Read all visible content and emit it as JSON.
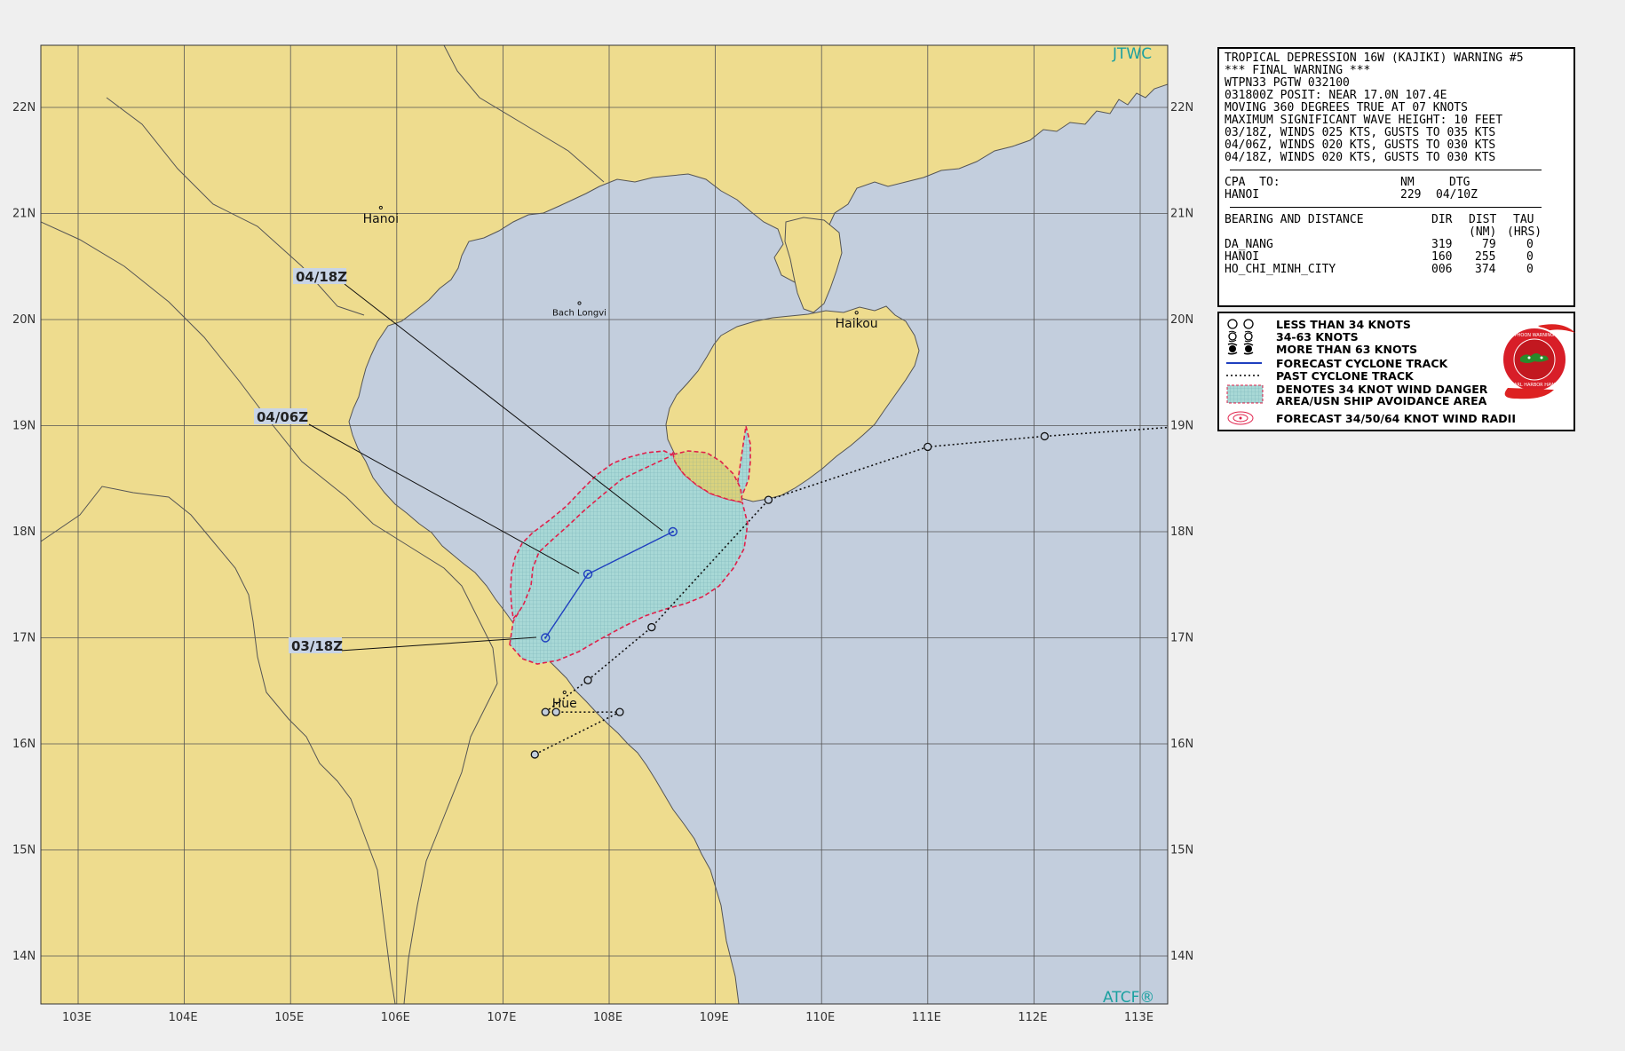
{
  "map": {
    "lat_labels": [
      "22N",
      "21N",
      "20N",
      "19N",
      "18N",
      "17N",
      "16N",
      "15N",
      "14N"
    ],
    "lon_labels": [
      "103E",
      "104E",
      "105E",
      "106E",
      "107E",
      "108E",
      "109E",
      "110E",
      "111E",
      "112E",
      "113E"
    ],
    "places": [
      {
        "name": "Hanoi",
        "lon": 105.85,
        "lat": 21.03
      },
      {
        "name": "Bach Longvi",
        "lon": 107.72,
        "lat": 20.13
      },
      {
        "name": "Haikou",
        "lon": 110.33,
        "lat": 20.04
      },
      {
        "name": "Hue",
        "lon": 107.58,
        "lat": 16.46
      }
    ],
    "brand_top": "JTWC",
    "brand_bottom": "ATCF®",
    "forecast_track": [
      {
        "tau": "03/18Z",
        "lon": 107.4,
        "lat": 17.0
      },
      {
        "tau": "04/06Z",
        "lon": 107.8,
        "lat": 17.6
      },
      {
        "tau": "04/18Z",
        "lon": 108.6,
        "lat": 18.0
      }
    ],
    "past_track": [
      {
        "lon": 113.5,
        "lat": 19.0
      },
      {
        "lon": 112.1,
        "lat": 18.9
      },
      {
        "lon": 111.0,
        "lat": 18.8
      },
      {
        "lon": 109.5,
        "lat": 18.3
      },
      {
        "lon": 108.4,
        "lat": 17.1
      },
      {
        "lon": 107.8,
        "lat": 16.6
      },
      {
        "lon": 107.4,
        "lat": 16.3
      },
      {
        "lon": 107.5,
        "lat": 16.3
      },
      {
        "lon": 108.1,
        "lat": 16.3
      },
      {
        "lon": 107.3,
        "lat": 15.9
      }
    ]
  },
  "colors": {
    "land": "#eedc8e",
    "sea": "#c3cedd",
    "forecast_track": "#1f3fbf",
    "danger_fill": "#9fd3d3",
    "danger_edge": "#e0204a"
  },
  "info": {
    "lines": [
      "TROPICAL DEPRESSION 16W (KAJIKI) WARNING #5",
      "*** FINAL WARNING ***",
      "WTPN33 PGTW 032100",
      "031800Z POSIT: NEAR 17.0N 107.4E",
      "MOVING 360 DEGREES TRUE AT 07 KNOTS",
      "MAXIMUM SIGNIFICANT WAVE HEIGHT: 10 FEET",
      "03/18Z, WINDS 025 KTS, GUSTS TO 035 KTS",
      "04/06Z, WINDS 020 KTS, GUSTS TO 030 KTS",
      "04/18Z, WINDS 020 KTS, GUSTS TO 030 KTS"
    ],
    "cpa": {
      "label": "CPA  TO:",
      "nm_header": "NM",
      "dtg_header": "DTG",
      "place": "HANOI",
      "nm": "229",
      "dtg": "04/10Z"
    },
    "bearing": {
      "title": "BEARING AND DISTANCE",
      "h_dir": "DIR",
      "h_dist": "DIST",
      "h_tau": "TAU",
      "h_dist2": "(NM)",
      "h_tau2": "(HRS)",
      "rows": [
        {
          "name": "DA_NANG",
          "dir": "319",
          "dist": "79",
          "tau": "0"
        },
        {
          "name": "HANOI",
          "dir": "160",
          "dist": "255",
          "tau": "0"
        },
        {
          "name": "HO_CHI_MINH_CITY",
          "dir": "006",
          "dist": "374",
          "tau": "0"
        }
      ]
    }
  },
  "legend": {
    "items": [
      "LESS THAN 34 KNOTS",
      "34-63 KNOTS",
      "MORE THAN 63 KNOTS",
      "FORECAST CYCLONE TRACK",
      "PAST CYCLONE TRACK",
      "DENOTES 34 KNOT WIND DANGER",
      "AREA/USN SHIP AVOIDANCE AREA",
      "FORECAST 34/50/64 KNOT WIND RADII"
    ],
    "seal_top": "JOINT TYPHOON WARNING CENTER",
    "seal_bottom": "PEARL HARBOR HAWAII"
  }
}
